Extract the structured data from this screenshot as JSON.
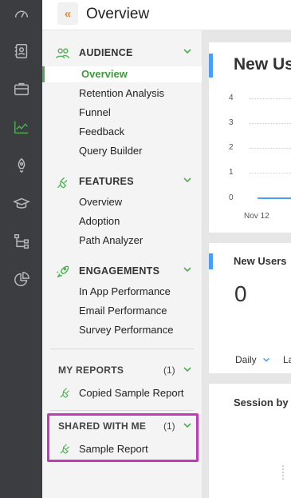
{
  "header": {
    "title": "Overview",
    "collapse_icon": "double-chevron-left-icon"
  },
  "colors": {
    "accent_green": "#4caf50",
    "highlight": "#c23bb6",
    "orange": "#e58a2b",
    "blue": "#4a9ff5",
    "rail_bg": "#3b3d40"
  },
  "rail": [
    {
      "icon": "speedometer-icon"
    },
    {
      "icon": "contacts-icon"
    },
    {
      "icon": "briefcase-icon"
    },
    {
      "icon": "line-chart-icon",
      "active": true
    },
    {
      "icon": "rocket-icon"
    },
    {
      "icon": "graduation-cap-icon"
    },
    {
      "icon": "flow-tree-icon"
    },
    {
      "icon": "pie-chart-icon"
    }
  ],
  "nav": {
    "audience": {
      "title": "AUDIENCE",
      "items": [
        "Overview",
        "Retention Analysis",
        "Funnel",
        "Feedback",
        "Query Builder"
      ]
    },
    "features": {
      "title": "FEATURES",
      "items": [
        "Overview",
        "Adoption",
        "Path Analyzer"
      ]
    },
    "engagements": {
      "title": "ENGAGEMENTS",
      "items": [
        "In App Performance",
        "Email Performance",
        "Survey Performance"
      ]
    },
    "my_reports": {
      "title": "MY REPORTS",
      "count": "(1)",
      "items": [
        "Copied Sample Report"
      ]
    },
    "shared": {
      "title": "SHARED WITH ME",
      "count": "(1)",
      "items": [
        "Sample Report"
      ]
    }
  },
  "main": {
    "card1": {
      "title": "New Us",
      "y_ticks": [
        "4",
        "3",
        "2",
        "1",
        "0"
      ],
      "x_tick": "Nov 12"
    },
    "card2": {
      "title": "New Users",
      "value": "0",
      "period": "Daily",
      "range": "La"
    },
    "card3": {
      "title": "Session by"
    }
  }
}
